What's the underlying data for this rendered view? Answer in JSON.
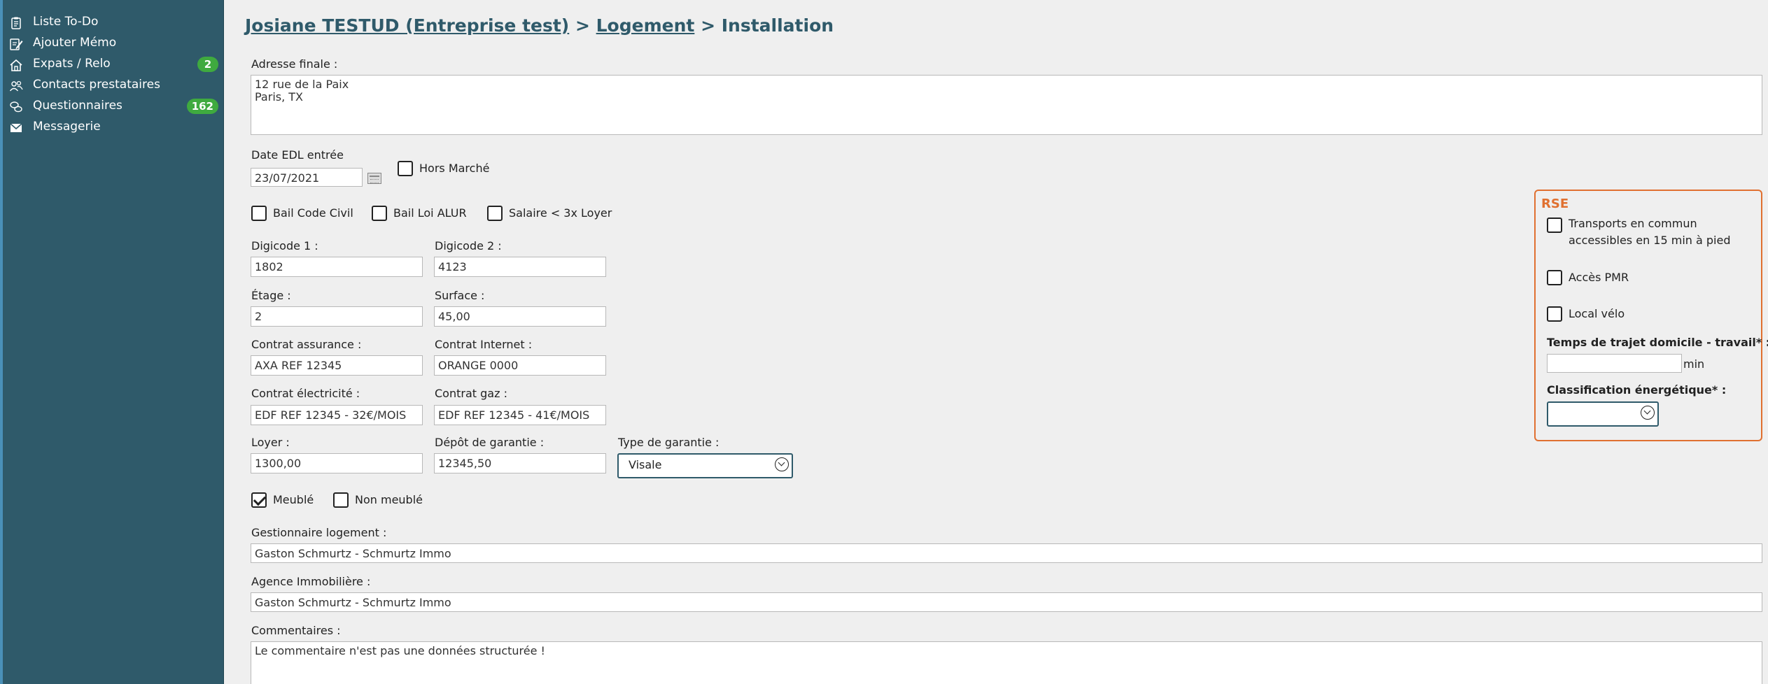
{
  "sidebar": {
    "items": [
      {
        "label": "Liste To-Do",
        "icon": "clipboard-list-icon",
        "badge": ""
      },
      {
        "label": "Ajouter Mémo",
        "icon": "edit-note-icon",
        "badge": ""
      },
      {
        "label": "Expats / Relo",
        "icon": "home-icon",
        "badge": "2"
      },
      {
        "label": "Contacts prestataires",
        "icon": "contacts-icon",
        "badge": ""
      },
      {
        "label": "Questionnaires",
        "icon": "chat-bubbles-icon",
        "badge": "162"
      },
      {
        "label": "Messagerie",
        "icon": "mail-icon",
        "badge": ""
      }
    ]
  },
  "breadcrumb": {
    "client": "Josiane TESTUD (Entreprise test)",
    "sep": ">",
    "section": "Logement",
    "current": "Installation"
  },
  "form": {
    "adresse_label": "Adresse finale :",
    "adresse_line1": "12 rue de la Paix",
    "adresse_line2": "Paris, TX",
    "date_edl_label": "Date EDL entrée",
    "date_edl_value": "23/07/2021",
    "hors_marche_label": "Hors Marché",
    "bail_code_civil_label": "Bail Code Civil",
    "bail_loi_alur_label": "Bail Loi ALUR",
    "salaire_label": "Salaire < 3x Loyer",
    "digicode1_label": "Digicode 1 :",
    "digicode1_value": "1802",
    "digicode2_label": "Digicode 2 :",
    "digicode2_value": "4123",
    "etage_label": "Étage :",
    "etage_value": "2",
    "surface_label": "Surface :",
    "surface_value": "45,00",
    "assurance_label": "Contrat assurance :",
    "assurance_value": "AXA REF 12345",
    "internet_label": "Contrat Internet :",
    "internet_value": "ORANGE  0000",
    "electricite_label": "Contrat électricité :",
    "electricite_value": "EDF REF 12345 - 32€/MOIS",
    "gaz_label": "Contrat gaz :",
    "gaz_value": "EDF REF 12345 - 41€/MOIS",
    "loyer_label": "Loyer :",
    "loyer_value": "1300,00",
    "depot_label": "Dépôt de garantie :",
    "depot_value": "12345,50",
    "type_garantie_label": "Type de garantie :",
    "type_garantie_value": "Visale",
    "meuble_label": "Meublé",
    "meuble_checked": true,
    "non_meuble_label": "Non meublé",
    "gestionnaire_label": "Gestionnaire logement :",
    "gestionnaire_value": "Gaston Schmurtz - Schmurtz Immo",
    "agence_label": "Agence Immobilière :",
    "agence_value": "Gaston Schmurtz - Schmurtz Immo",
    "commentaires_label": "Commentaires :",
    "commentaires_value": "Le commentaire n'est pas une données structurée !"
  },
  "rse": {
    "title": "RSE",
    "transports_line1": "Transports en commun",
    "transports_line2": "accessibles en 15 min à pied",
    "pmr_label": "Accès PMR",
    "velo_label": "Local vélo",
    "trajet_label": "Temps de trajet domicile - travail* :",
    "trajet_value": "",
    "trajet_unit": "min",
    "classification_label": "Classification énergétique* :",
    "classification_value": ""
  },
  "colors": {
    "sidebar_bg": "#2f5a6a",
    "badge_green": "#3faa3f",
    "rse_orange": "#e07030",
    "breadcrumb": "#2f5a6a"
  }
}
